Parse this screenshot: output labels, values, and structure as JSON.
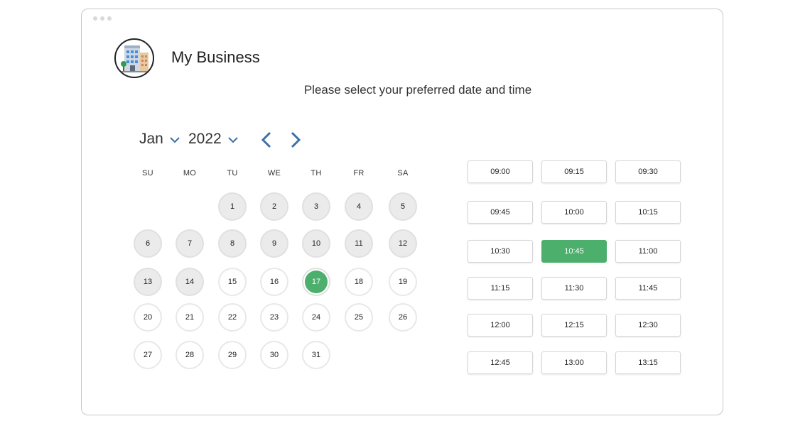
{
  "business": {
    "name": "My Business",
    "logo_icon": "office-building-icon"
  },
  "subtitle": "Please select your preferred date and time",
  "calendar": {
    "month": "Jan",
    "year": "2022",
    "weekdays": [
      "SU",
      "MO",
      "TU",
      "WE",
      "TH",
      "FR",
      "SA"
    ],
    "first_weekday_index": 2,
    "days_in_month": 31,
    "selected_day": 17,
    "past_days_through": 14,
    "prev_icon": "chevron-left-icon",
    "next_icon": "chevron-right-icon"
  },
  "times": {
    "slots": [
      "09:00",
      "09:15",
      "09:30",
      "09:45",
      "10:00",
      "10:15",
      "10:30",
      "10:45",
      "11:00",
      "11:15",
      "11:30",
      "11:45",
      "12:00",
      "12:15",
      "12:30",
      "12:45",
      "13:00",
      "13:15"
    ],
    "selected": "10:45"
  },
  "colors": {
    "accent": "#4caf6b",
    "nav": "#3d6fa8"
  }
}
